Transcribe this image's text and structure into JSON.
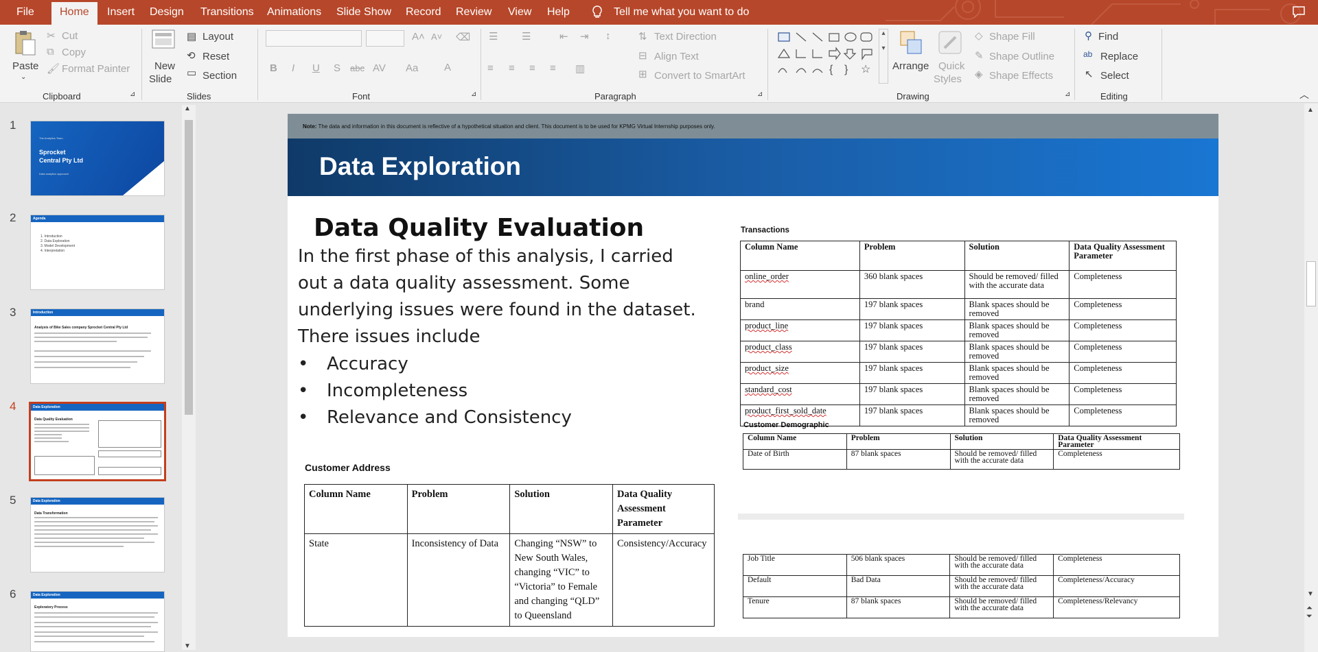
{
  "menu": {
    "file": "File",
    "tabs": [
      "Home",
      "Insert",
      "Design",
      "Transitions",
      "Animations",
      "Slide Show",
      "Record",
      "Review",
      "View",
      "Help"
    ],
    "tell_me": "Tell me what you want to do"
  },
  "ribbon": {
    "clipboard": {
      "paste": "Paste",
      "cut": "Cut",
      "copy": "Copy",
      "format_painter": "Format Painter",
      "label": "Clipboard"
    },
    "slides": {
      "new_slide": "New",
      "new_slide2": "Slide",
      "layout": "Layout",
      "reset": "Reset",
      "section": "Section",
      "label": "Slides"
    },
    "font": {
      "label": "Font",
      "bold": "B",
      "italic": "I",
      "underline": "U",
      "shadow": "S",
      "strike": "abc",
      "spacing": "AV",
      "case": "Aa",
      "color": "A"
    },
    "paragraph": {
      "text_direction": "Text Direction",
      "align_text": "Align Text",
      "smartart": "Convert to SmartArt",
      "label": "Paragraph"
    },
    "drawing": {
      "arrange": "Arrange",
      "quick_styles": "Quick",
      "quick_styles2": "Styles",
      "shape_fill": "Shape Fill",
      "shape_outline": "Shape Outline",
      "shape_effects": "Shape Effects",
      "label": "Drawing"
    },
    "editing": {
      "find": "Find",
      "replace": "Replace",
      "select": "Select",
      "label": "Editing"
    }
  },
  "thumbnails": {
    "numbers": [
      "1",
      "2",
      "3",
      "4",
      "5",
      "6"
    ],
    "t1_small": "The Analytics Team",
    "t1_title": "Sprocket",
    "t1_title2": "Central Pty Ltd",
    "t1_sub": "Data analytics approach",
    "t2_hdr": "Agenda",
    "t2_items": [
      "1.  Introduction",
      "2.  Data Exploration",
      "3.  Model Development",
      "4.  Interpretation"
    ],
    "t3_hdr": "Introduction",
    "t3_title": "Analysis of Bike Sales company Sprocket Central Pty Ltd",
    "t4_hdr": "Data Exploration",
    "t4_title": "Data Quality Evaluation",
    "t5_hdr": "Data Exploration",
    "t5_title": "Data Transformation",
    "t6_hdr": "Data Exploration",
    "t6_title": "Exploratory Process"
  },
  "slide": {
    "note_label": "Note:",
    "note_text": " The data and information in this document is reflective of a hypothetical situation and client. This document is to be used for KPMG Virtual Internship purposes only.",
    "title": "Data Exploration",
    "heading": "Data Quality Evaluation",
    "intro": "In the first phase of this analysis, I carried out a data quality assessment. Some underlying issues were found in the dataset. There issues include",
    "issues": [
      "Accuracy",
      "Incompleteness",
      "Relevance and Consistency"
    ],
    "addr_title": "Customer Address",
    "addr_headers": [
      "Column Name",
      "Problem",
      "Solution",
      "Data Quality Assessment Parameter"
    ],
    "addr_row": [
      "State",
      "Inconsistency of Data",
      "Changing “NSW” to New South Wales, changing “VIC” to “Victoria” to Female and changing “QLD” to Queensland",
      "Consistency/Accuracy"
    ],
    "trans_title": "Transactions",
    "trans_headers": [
      "Column Name",
      "Problem",
      "Solution",
      "Data Quality Assessment Parameter"
    ],
    "trans_rows": [
      [
        "online_order",
        "360 blank spaces",
        "Should be removed/ filled with the accurate data",
        "Completeness"
      ],
      [
        "brand",
        "197 blank spaces",
        "Blank spaces should be removed",
        "Completeness"
      ],
      [
        "product_line",
        "197 blank spaces",
        "Blank spaces should be removed",
        "Completeness"
      ],
      [
        "product_class",
        "197 blank spaces",
        "Blank spaces should be removed",
        "Completeness"
      ],
      [
        "product_size",
        "197 blank spaces",
        "Blank spaces should be removed",
        "Completeness"
      ],
      [
        "standard_cost",
        "197 blank spaces",
        "Blank spaces should be removed",
        "Completeness"
      ],
      [
        "product_first_sold_date",
        "197 blank spaces",
        "Blank spaces should be removed",
        "Completeness"
      ]
    ],
    "cd_title": "Customer Demographic",
    "cd_headers": [
      "Column Name",
      "Problem",
      "Solution",
      "Data Quality Assessment Parameter"
    ],
    "cd_row": [
      "Date of Birth",
      "87 blank spaces",
      "Should be removed/ filled with the accurate data",
      "Completeness"
    ],
    "ex_rows": [
      [
        "Job Title",
        "506 blank spaces",
        "Should be removed/ filled with the accurate data",
        "Completeness"
      ],
      [
        "Default",
        "Bad Data",
        "Should be removed/ filled with the accurate data",
        "Completeness/Accuracy"
      ],
      [
        "Tenure",
        "87 blank spaces",
        "Should be removed/ filled with the accurate data",
        "Completeness/Relevancy"
      ]
    ]
  }
}
